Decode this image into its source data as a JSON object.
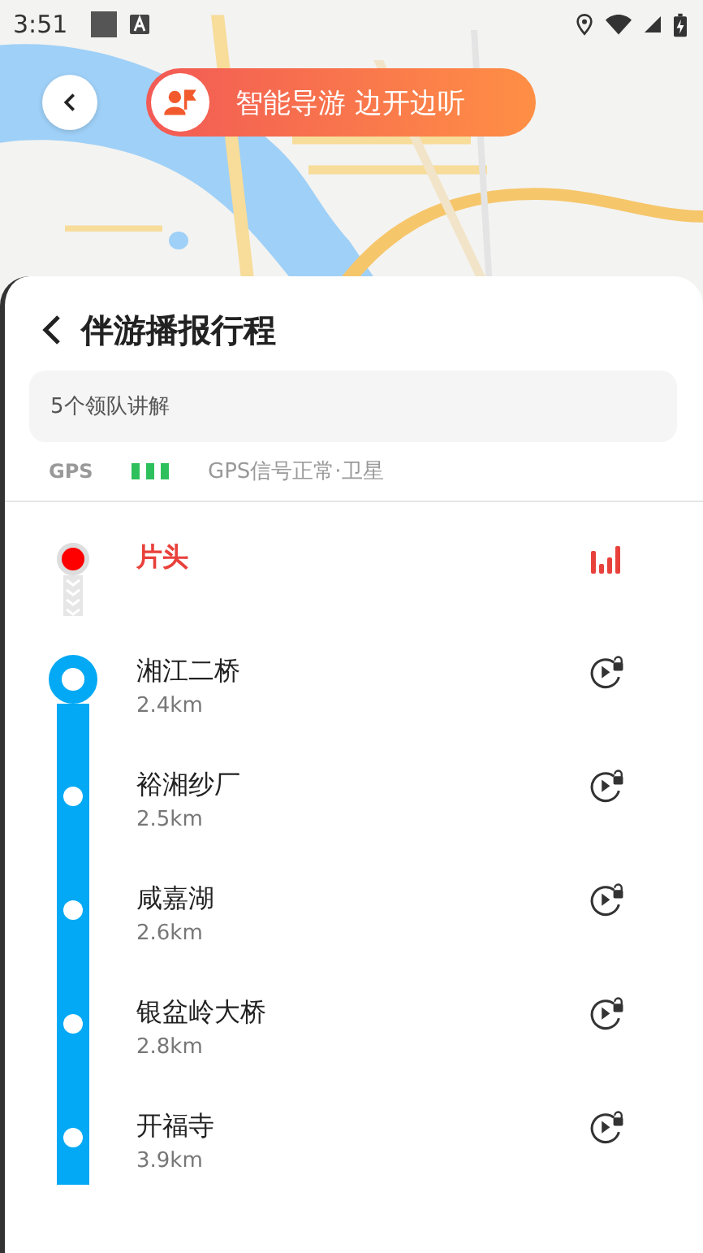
{
  "status_bar": {
    "time": "3:51"
  },
  "banner": {
    "label": "智能导游 边开边听"
  },
  "panel": {
    "title": "伴游播报行程",
    "summary": "5个领队讲解",
    "gps_label": "GPS",
    "gps_status": "GPS信号正常·卫星"
  },
  "stops": [
    {
      "kind": "intro",
      "name": "片头",
      "playing": true,
      "current": false
    },
    {
      "kind": "stop",
      "name": "湘江二桥",
      "distance": "2.4km",
      "playing": false,
      "current": true
    },
    {
      "kind": "stop",
      "name": "裕湘纱厂",
      "distance": "2.5km",
      "playing": false,
      "current": false
    },
    {
      "kind": "stop",
      "name": "咸嘉湖",
      "distance": "2.6km",
      "playing": false,
      "current": false
    },
    {
      "kind": "stop",
      "name": "银盆岭大桥",
      "distance": "2.8km",
      "playing": false,
      "current": false
    },
    {
      "kind": "stop",
      "name": "开福寺",
      "distance": "3.9km",
      "playing": false,
      "current": false
    }
  ]
}
